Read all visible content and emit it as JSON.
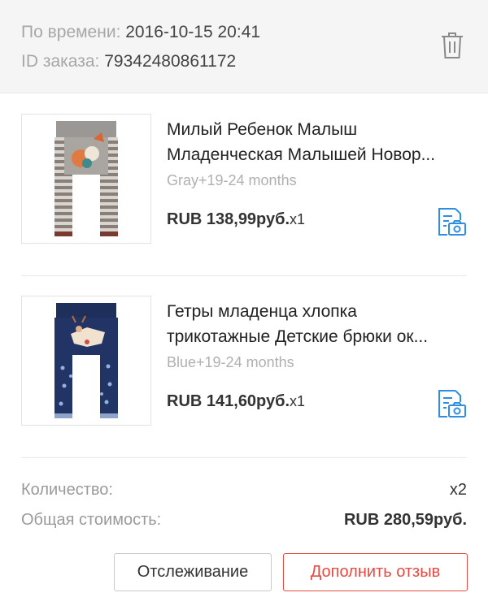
{
  "order": {
    "time_label": "По времени:",
    "time_value": "2016-10-15 20:41",
    "id_label": "ID заказа:",
    "id_value": "79342480861172"
  },
  "items": [
    {
      "title_line1": "Милый Ребенок Малыш",
      "title_line2": "Младенческая Малышей Новор...",
      "variant": "Gray+19-24 months",
      "price": "RUB 138,99руб.",
      "qty": "x1"
    },
    {
      "title_line1": "Гетры младенца хлопка",
      "title_line2": "трикотажные Детские брюки ок...",
      "variant": "Blue+19-24 months",
      "price": "RUB 141,60руб.",
      "qty": "x1"
    }
  ],
  "summary": {
    "quantity_label": "Количество:",
    "quantity_value": "x2",
    "total_label": "Общая стоимость:",
    "total_value": "RUB 280,59руб."
  },
  "actions": {
    "track_label": "Отслеживание",
    "review_label": "Дополнить отзыв"
  },
  "icons": {
    "delete": "trash-icon",
    "review": "add-review-photo-icon"
  },
  "colors": {
    "accent_blue": "#2e8ee0",
    "accent_red": "#e64a43"
  }
}
